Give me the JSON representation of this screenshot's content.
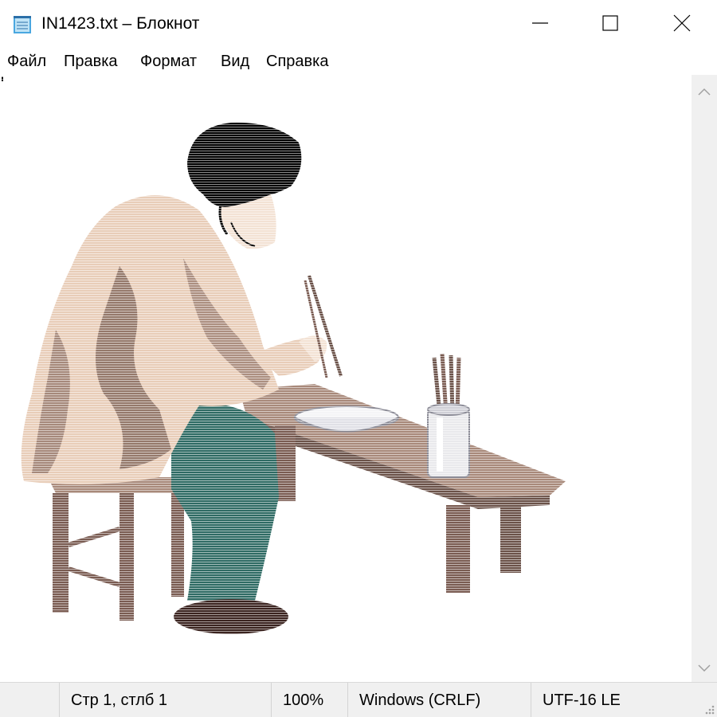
{
  "window": {
    "title": "IN1423.txt – Блокнот",
    "controls": {
      "minimize": "—",
      "maximize": "☐",
      "close": "✕"
    }
  },
  "menu": {
    "items": [
      "Файл",
      "Правка",
      "Формат",
      "Вид",
      "Справка"
    ]
  },
  "document": {
    "content_kind": "ascii-art illustration of a seated person eating at a bench with a bowl and a cup of chopsticks",
    "colors": {
      "hair": "#000000",
      "coat": "#e8cdb8",
      "coat_shadow": "#7a5c52",
      "trousers": "#2f6b64",
      "bench": "#a8897a",
      "bench_dark": "#6b5249",
      "shoes": "#3b2420",
      "cup": "#e9e9ec"
    }
  },
  "status": {
    "position": "Стр 1, стлб 1",
    "zoom": "100%",
    "line_endings": "Windows (CRLF)",
    "encoding": "UTF-16 LE"
  },
  "theme": {
    "status_bg": "#f0f0f0",
    "scrollbar_bg": "#f0f0f0"
  }
}
